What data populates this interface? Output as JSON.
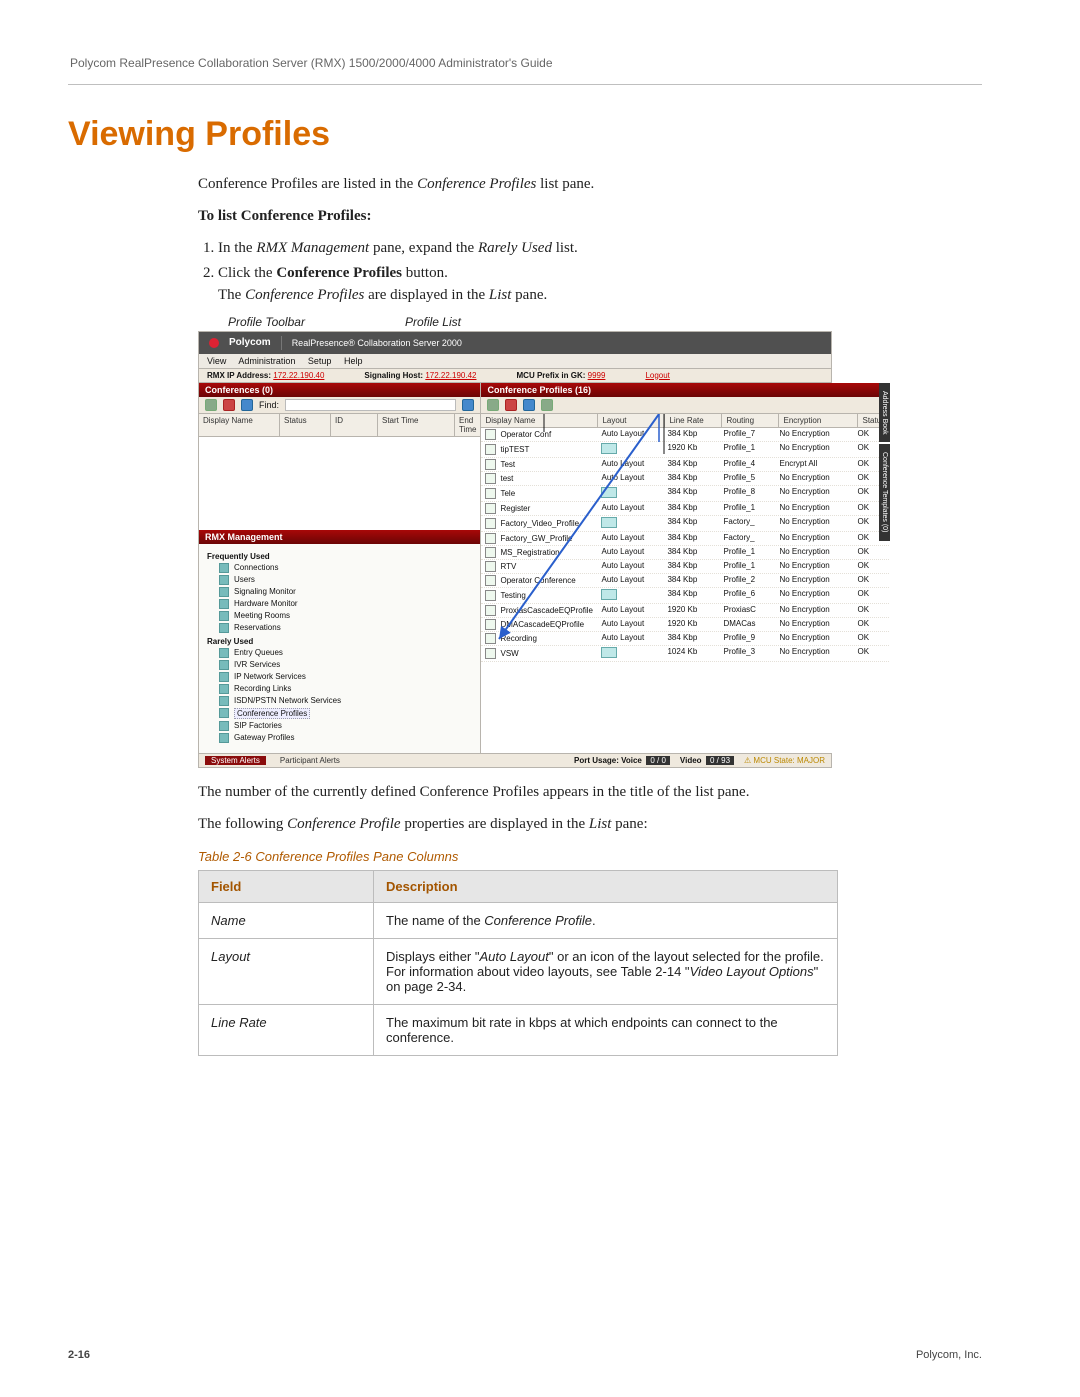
{
  "running_head": "Polycom RealPresence Collaboration Server (RMX) 1500/2000/4000 Administrator's Guide",
  "h1": "Viewing Profiles",
  "intro_before": "Conference Profiles are listed in the ",
  "intro_em": "Conference Profiles",
  "intro_after": " list pane.",
  "subhead": "To list Conference Profiles:",
  "step1_a": "In the ",
  "step1_em1": "RMX Management",
  "step1_b": " pane, expand the ",
  "step1_em2": "Rarely Used",
  "step1_c": " list.",
  "step2_a": "Click the ",
  "step2_bold": "Conference Profiles",
  "step2_b": " button.",
  "result_a": "The ",
  "result_em1": "Conference Profiles",
  "result_b": " are displayed in the ",
  "result_em2": "List",
  "result_c": " pane.",
  "callout_toolbar": "Profile Toolbar",
  "callout_list": "Profile List",
  "app": {
    "brand": "Polycom",
    "title": "RealPresence® Collaboration Server 2000",
    "menu": [
      "View",
      "Administration",
      "Setup",
      "Help"
    ],
    "addr_ip_label": "RMX IP Address:",
    "addr_ip": "172.22.190.40",
    "sig_host_label": "Signaling Host:",
    "sig_host": "172.22.190.42",
    "mcu_label": "MCU Prefix in GK:",
    "mcu": "9999",
    "logout": "Logout",
    "conferences_title": "Conferences (0)",
    "find_label": "Find:",
    "conf_cols": [
      "Display Name",
      "Status",
      "ID",
      "Start Time",
      "End Time"
    ],
    "profiles_title": "Conference Profiles (16)",
    "profile_cols": [
      "Display Name",
      "Layout",
      "Line Rate",
      "Routing",
      "Encryption",
      "Status"
    ],
    "management_title": "RMX Management",
    "tree_freq": "Frequently Used",
    "tree_freq_items": [
      "Connections",
      "Users",
      "Signaling Monitor",
      "Hardware Monitor",
      "Meeting Rooms",
      "Reservations"
    ],
    "tree_rare": "Rarely Used",
    "tree_rare_items": [
      "Entry Queues",
      "IVR Services",
      "IP Network Services",
      "Recording Links",
      "ISDN/PSTN Network Services",
      "Conference Profiles",
      "SIP Factories",
      "Gateway Profiles"
    ],
    "rows": [
      {
        "name": "Operator Conf",
        "layout": "Auto Layout",
        "rate": "384 Kbp",
        "routing": "Profile_7",
        "enc": "No Encryption",
        "status": "OK"
      },
      {
        "name": "tipTEST",
        "layout": "",
        "rate": "1920 Kb",
        "routing": "Profile_1",
        "enc": "No Encryption",
        "status": "OK"
      },
      {
        "name": "Test",
        "layout": "Auto Layout",
        "rate": "384 Kbp",
        "routing": "Profile_4",
        "enc": "Encrypt All",
        "status": "OK"
      },
      {
        "name": "test",
        "layout": "Auto Layout",
        "rate": "384 Kbp",
        "routing": "Profile_5",
        "enc": "No Encryption",
        "status": "OK"
      },
      {
        "name": "Tele",
        "layout": "",
        "rate": "384 Kbp",
        "routing": "Profile_8",
        "enc": "No Encryption",
        "status": "OK"
      },
      {
        "name": "Register",
        "layout": "Auto Layout",
        "rate": "384 Kbp",
        "routing": "Profile_1",
        "enc": "No Encryption",
        "status": "OK"
      },
      {
        "name": "Factory_Video_Profile",
        "layout": "",
        "rate": "384 Kbp",
        "routing": "Factory_",
        "enc": "No Encryption",
        "status": "OK"
      },
      {
        "name": "Factory_GW_Profile",
        "layout": "Auto Layout",
        "rate": "384 Kbp",
        "routing": "Factory_",
        "enc": "No Encryption",
        "status": "OK"
      },
      {
        "name": "MS_Registration",
        "layout": "Auto Layout",
        "rate": "384 Kbp",
        "routing": "Profile_1",
        "enc": "No Encryption",
        "status": "OK"
      },
      {
        "name": "RTV",
        "layout": "Auto Layout",
        "rate": "384 Kbp",
        "routing": "Profile_1",
        "enc": "No Encryption",
        "status": "OK"
      },
      {
        "name": "Operator Conference",
        "layout": "Auto Layout",
        "rate": "384 Kbp",
        "routing": "Profile_2",
        "enc": "No Encryption",
        "status": "OK"
      },
      {
        "name": "Testing",
        "layout": "",
        "rate": "384 Kbp",
        "routing": "Profile_6",
        "enc": "No Encryption",
        "status": "OK"
      },
      {
        "name": "ProxiasCascadeEQProfile",
        "layout": "Auto Layout",
        "rate": "1920 Kb",
        "routing": "ProxiasC",
        "enc": "No Encryption",
        "status": "OK"
      },
      {
        "name": "DMACascadeEQProfile",
        "layout": "Auto Layout",
        "rate": "1920 Kb",
        "routing": "DMACas",
        "enc": "No Encryption",
        "status": "OK"
      },
      {
        "name": "Recording",
        "layout": "Auto Layout",
        "rate": "384 Kbp",
        "routing": "Profile_9",
        "enc": "No Encryption",
        "status": "OK"
      },
      {
        "name": "VSW",
        "layout": "",
        "rate": "1024 Kb",
        "routing": "Profile_3",
        "enc": "No Encryption",
        "status": "OK"
      }
    ],
    "side_tab1": "Address Book",
    "side_tab2": "Conference Templates (0)",
    "sys_alerts": "System Alerts",
    "part_alerts": "Participant Alerts",
    "port_label": "Port Usage:  Voice",
    "port_voice": "0 / 0",
    "port_video_label": "Video",
    "port_video": "0 / 93",
    "mcu_state": "MCU State: MAJOR"
  },
  "para2": "The number of the currently defined Conference Profiles appears in the title of the list pane.",
  "para3_a": "The following ",
  "para3_em": "Conference Profile",
  "para3_b": " properties are displayed in the ",
  "para3_em2": "List",
  "para3_c": " pane:",
  "table_caption": "Table 2-6   Conference Profiles Pane Columns",
  "th_field": "Field",
  "th_desc": "Description",
  "trows": [
    {
      "f": "Name",
      "d_a": "The name of the ",
      "d_em": "Conference Profile",
      "d_b": "."
    },
    {
      "f": "Layout",
      "d_a": "Displays either \"",
      "d_em": "Auto Layout",
      "d_b": "\" or an icon of the layout selected for the profile.\nFor information about video layouts, see Table 2-14 \"",
      "d_em2": "Video Layout Options",
      "d_c": "\" on page 2-34."
    },
    {
      "f": "Line Rate",
      "d_a": "The maximum bit rate in kbps at which endpoints can connect to the conference.",
      "d_em": "",
      "d_b": ""
    }
  ],
  "footer_page": "2-16",
  "footer_right": "Polycom, Inc."
}
